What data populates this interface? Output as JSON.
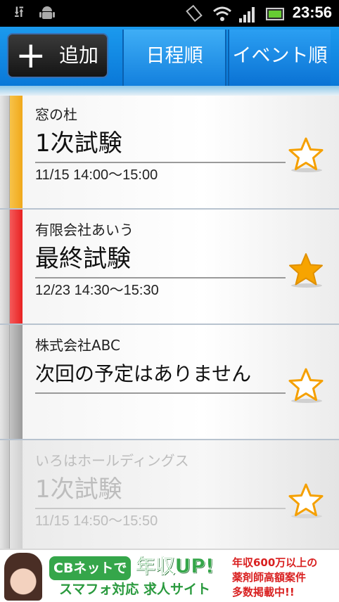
{
  "status_bar": {
    "time": "23:56",
    "icons": [
      "usb-icon",
      "android-debug-icon",
      "rotate-icon",
      "wifi-icon",
      "signal-icon",
      "battery-icon"
    ]
  },
  "toolbar": {
    "add_icon": "+",
    "add_label": "追加",
    "tabs": [
      {
        "label": "日程順",
        "selected": true
      },
      {
        "label": "イベント順",
        "selected": false
      }
    ]
  },
  "events": [
    {
      "company": "窓の杜",
      "title": "1次試験",
      "time": "11/15 14:00〜15:00",
      "bar_color": "#f5b52a",
      "starred": false,
      "dimmed": false
    },
    {
      "company": "有限会社あいう",
      "title": "最終試験",
      "time": "12/23 14:30〜15:30",
      "bar_color": "#ee2f2f",
      "starred": true,
      "dimmed": false
    },
    {
      "company": "株式会社ABC",
      "title": "次回の予定はありません",
      "time": "",
      "bar_color": "#a8a8a8",
      "starred": false,
      "dimmed": false
    },
    {
      "company": "いろはホールディングス",
      "title": "1次試験",
      "time": "11/15 14:50〜15:50",
      "bar_color": "#d6d6d6",
      "starred": false,
      "dimmed": true
    }
  ],
  "ad": {
    "brand": "CBネットで",
    "headline": "年収UP!",
    "subline": "スマフォ対応 求人サイト",
    "right_lines": [
      "年収600万以上の",
      "薬剤師高額案件",
      "多数掲載中!!"
    ]
  },
  "colors": {
    "accent": "#1b8ce8",
    "star_filled": "#f5a000",
    "star_outline": "#f5a000"
  }
}
